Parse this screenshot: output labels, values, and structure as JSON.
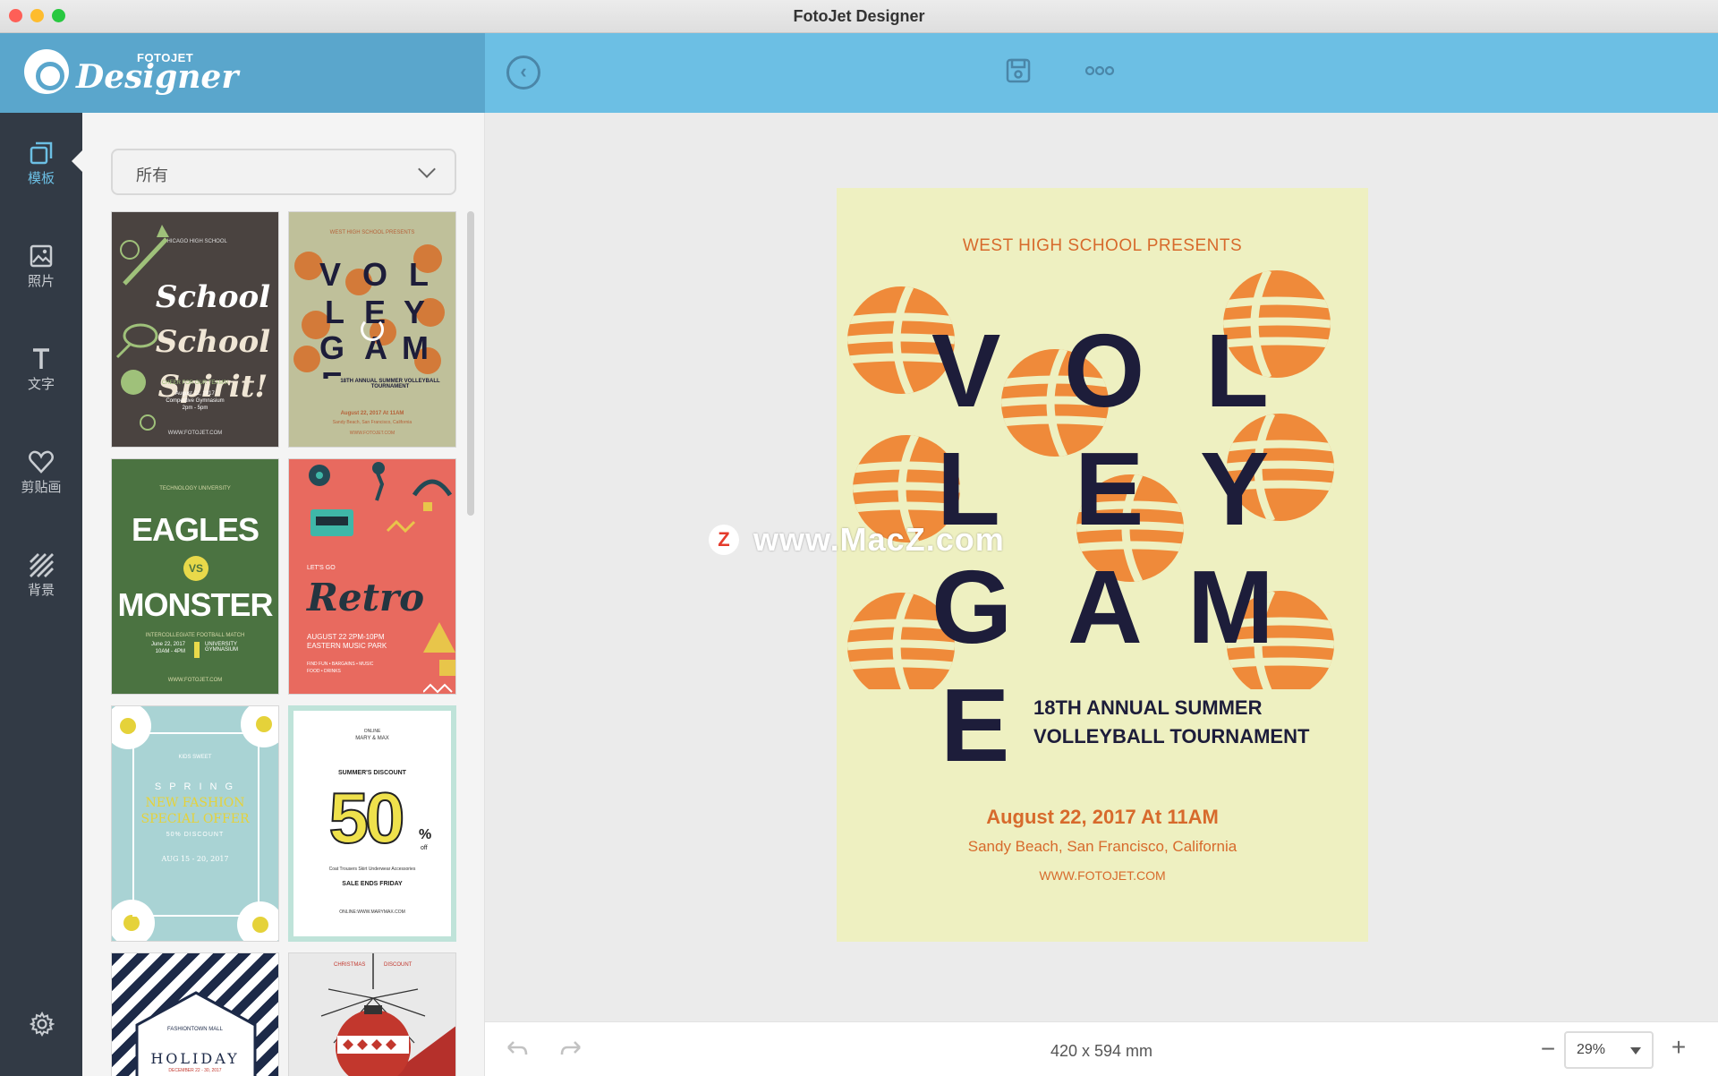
{
  "window": {
    "title": "FotoJet Designer"
  },
  "logo": {
    "small": "FOTOJET",
    "big": "Designer"
  },
  "nav": {
    "items": [
      {
        "label": "模板",
        "icon": "templates-icon"
      },
      {
        "label": "照片",
        "icon": "photo-icon"
      },
      {
        "label": "文字",
        "icon": "text-icon"
      },
      {
        "label": "剪贴画",
        "icon": "clipart-heart-icon"
      },
      {
        "label": "背景",
        "icon": "background-icon"
      }
    ],
    "settings_icon": "gear-icon"
  },
  "panel": {
    "filter_value": "所有",
    "templates": [
      {
        "name": "school-spirit",
        "top": "CHICAGO HIGH SCHOOL",
        "title": "School Spirit!",
        "sub": "CHEER FOR OUR TEAMS!",
        "date": "August 22, 2017",
        "place": "Competitive Gymnasium",
        "time": "2pm - 5pm",
        "url": "WWW.FOTOJET.COM"
      },
      {
        "name": "volley-game",
        "top": "WEST HIGH SCHOOL PRESENTS",
        "title": "VOLLEY GAME",
        "sub": "18TH ANNUAL SUMMER VOLLEYBALL TOURNAMENT",
        "date": "August 22, 2017 At 11AM",
        "place": "Sandy Beach, San Francisco, California",
        "url": "WWW.FOTOJET.COM"
      },
      {
        "name": "eagles-vs-monster",
        "top": "TECHNOLOGY UNIVERSITY",
        "title1": "EAGLES",
        "vs": "VS",
        "title2": "MONSTER",
        "sub": "INTERCOLLEGIATE FOOTBALL MATCH",
        "date": "June 22, 2017",
        "time": "10AM - 4PM",
        "place": "UNIVERSITY GYMNASIUM",
        "url": "WWW.FOTOJET.COM"
      },
      {
        "name": "retro",
        "top": "LET'S GO",
        "title": "Retro",
        "date": "AUGUST 22 2PM-10PM",
        "place": "EASTERN MUSIC PARK",
        "sub": "FIND FUN • BARGAINS • MUSIC",
        "sub2": "FOOD • DRINKS"
      },
      {
        "name": "spring-fashion",
        "top": "KIDS SWEET",
        "title1": "S P R I N G",
        "title2": "NEW FASHION",
        "title3": "SPECIAL OFFER",
        "sub": "50% DISCOUNT",
        "date": "AUG 15 - 20, 2017"
      },
      {
        "name": "summer-discount",
        "top1": "ONLINE",
        "top2": "MARY & MAX",
        "title": "SUMMER'S DISCOUNT",
        "big": "50",
        "pct": "%",
        "off": "off",
        "items": "Coat   Trousers   Skirt   Underwear   Accessories",
        "sub": "SALE ENDS FRIDAY",
        "url": "ONLINE:WWW.MARYMAX.COM"
      },
      {
        "name": "holiday",
        "top": "FASHIONTOWN MALL",
        "title": "HOLIDAY",
        "date": "DECEMBER 22 - 30, 2017"
      },
      {
        "name": "christmas",
        "left": "CHRISTMAS",
        "right": "DISCOUNT"
      }
    ]
  },
  "poster": {
    "presents": "WEST HIGH SCHOOL PRESENTS",
    "letters": [
      "V",
      "O",
      "L",
      "L",
      "E",
      "Y",
      "G",
      "A",
      "M",
      "E"
    ],
    "annual_line1": "18TH ANNUAL SUMMER",
    "annual_line2": "VOLLEYBALL TOURNAMENT",
    "date": "August 22, 2017 At 11AM",
    "place": "Sandy Beach, San Francisco, California",
    "url": "WWW.FOTOJET.COM",
    "colors": {
      "bg": "#eef0c1",
      "ink": "#1d1d3a",
      "accent": "#e8782f",
      "ball": "#ef8a3a"
    }
  },
  "watermark": {
    "badge": "Z",
    "text": "www.MacZ.com"
  },
  "bottombar": {
    "size": "420 x 594 mm",
    "zoom": "29%",
    "minus": "−",
    "plus": "+"
  }
}
